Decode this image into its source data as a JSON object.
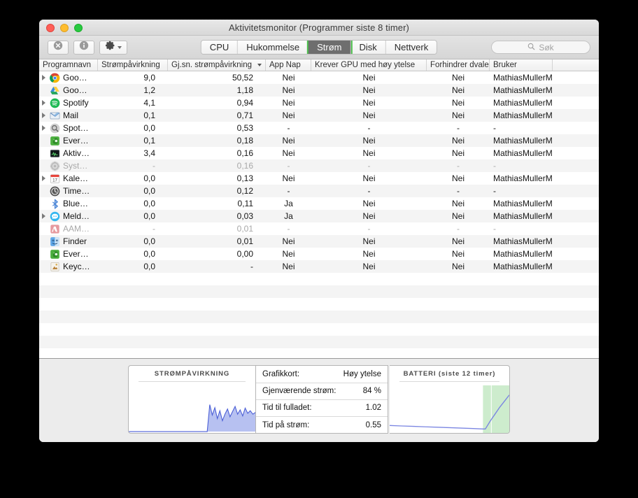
{
  "window": {
    "title": "Aktivitetsmonitor (Programmer siste 8 timer)",
    "traffic": {
      "close": "close-button",
      "minimize": "minimize-button",
      "maximize": "maximize-button"
    }
  },
  "toolbar": {
    "quit_process_icon": "stop-process-icon",
    "inspect_icon": "info-icon",
    "gear_icon": "gear-icon",
    "tabs": [
      {
        "label": "CPU",
        "selected": false
      },
      {
        "label": "Hukommelse",
        "selected": false
      },
      {
        "label": "Strøm",
        "selected": true
      },
      {
        "label": "Disk",
        "selected": false
      },
      {
        "label": "Nettverk",
        "selected": false
      }
    ],
    "search": {
      "placeholder": "Søk",
      "icon": "search-icon",
      "value": ""
    },
    "selected_tab_outline": "#4cc14c",
    "selected_tab_fill": "#6e6e6e"
  },
  "table": {
    "columns": [
      {
        "key": "name",
        "label": "Programnavn",
        "sorted": false
      },
      {
        "key": "imp",
        "label": "Strømpåvirkning",
        "sorted": false
      },
      {
        "key": "avg",
        "label": "Gj.sn. strømpåvirkning",
        "sorted": true
      },
      {
        "key": "nap",
        "label": "App Nap",
        "sorted": false
      },
      {
        "key": "gpu",
        "label": "Krever GPU med høy ytelse",
        "sorted": false
      },
      {
        "key": "sleep",
        "label": "Forhindrer dvale",
        "sorted": false
      },
      {
        "key": "user",
        "label": "Bruker",
        "sorted": false
      }
    ],
    "rows": [
      {
        "name": "Goo…",
        "icon": "chrome",
        "disclosure": true,
        "inactive": false,
        "imp": "9,0",
        "avg": "50,52",
        "nap": "Nei",
        "gpu": "Nei",
        "sleep": "Nei",
        "user": "MathiasMullerM"
      },
      {
        "name": "Goo…",
        "icon": "gdrive",
        "disclosure": false,
        "inactive": false,
        "imp": "1,2",
        "avg": "1,18",
        "nap": "Nei",
        "gpu": "Nei",
        "sleep": "Nei",
        "user": "MathiasMullerM"
      },
      {
        "name": "Spotify",
        "icon": "spotify",
        "disclosure": true,
        "inactive": false,
        "imp": "4,1",
        "avg": "0,94",
        "nap": "Nei",
        "gpu": "Nei",
        "sleep": "Nei",
        "user": "MathiasMullerM"
      },
      {
        "name": "Mail",
        "icon": "mail",
        "disclosure": true,
        "inactive": false,
        "imp": "0,1",
        "avg": "0,71",
        "nap": "Nei",
        "gpu": "Nei",
        "sleep": "Nei",
        "user": "MathiasMullerM"
      },
      {
        "name": "Spot…",
        "icon": "spotlight",
        "disclosure": true,
        "inactive": false,
        "imp": "0,0",
        "avg": "0,53",
        "nap": "-",
        "gpu": "-",
        "sleep": "-",
        "user": "-"
      },
      {
        "name": "Ever…",
        "icon": "evernote",
        "disclosure": false,
        "inactive": false,
        "imp": "0,1",
        "avg": "0,18",
        "nap": "Nei",
        "gpu": "Nei",
        "sleep": "Nei",
        "user": "MathiasMullerM"
      },
      {
        "name": "Aktiv…",
        "icon": "activity",
        "disclosure": false,
        "inactive": false,
        "imp": "3,4",
        "avg": "0,16",
        "nap": "Nei",
        "gpu": "Nei",
        "sleep": "Nei",
        "user": "MathiasMullerM"
      },
      {
        "name": "Syst…",
        "icon": "prefs",
        "disclosure": false,
        "inactive": true,
        "imp": "-",
        "avg": "0,16",
        "nap": "-",
        "gpu": "-",
        "sleep": "-",
        "user": "-"
      },
      {
        "name": "Kale…",
        "icon": "calendar",
        "disclosure": true,
        "inactive": false,
        "imp": "0,0",
        "avg": "0,13",
        "nap": "Nei",
        "gpu": "Nei",
        "sleep": "Nei",
        "user": "MathiasMullerM"
      },
      {
        "name": "Time…",
        "icon": "timemachine",
        "disclosure": false,
        "inactive": false,
        "imp": "0,0",
        "avg": "0,12",
        "nap": "-",
        "gpu": "-",
        "sleep": "-",
        "user": "-"
      },
      {
        "name": "Blue…",
        "icon": "bluetooth",
        "disclosure": false,
        "inactive": false,
        "imp": "0,0",
        "avg": "0,11",
        "nap": "Ja",
        "gpu": "Nei",
        "sleep": "Nei",
        "user": "MathiasMullerM"
      },
      {
        "name": "Meld…",
        "icon": "messages",
        "disclosure": true,
        "inactive": false,
        "imp": "0,0",
        "avg": "0,03",
        "nap": "Ja",
        "gpu": "Nei",
        "sleep": "Nei",
        "user": "MathiasMullerM"
      },
      {
        "name": "AAM…",
        "icon": "adobe",
        "disclosure": false,
        "inactive": true,
        "imp": "-",
        "avg": "0,01",
        "nap": "-",
        "gpu": "-",
        "sleep": "-",
        "user": "-"
      },
      {
        "name": "Finder",
        "icon": "finder",
        "disclosure": false,
        "inactive": false,
        "imp": "0,0",
        "avg": "0,01",
        "nap": "Nei",
        "gpu": "Nei",
        "sleep": "Nei",
        "user": "MathiasMullerM"
      },
      {
        "name": "Ever…",
        "icon": "evernote",
        "disclosure": false,
        "inactive": false,
        "imp": "0,0",
        "avg": "0,00",
        "nap": "Nei",
        "gpu": "Nei",
        "sleep": "Nei",
        "user": "MathiasMullerM"
      },
      {
        "name": "Keyc…",
        "icon": "keychain",
        "disclosure": false,
        "inactive": false,
        "imp": "0,0",
        "avg": "-",
        "nap": "Nei",
        "gpu": "Nei",
        "sleep": "Nei",
        "user": "MathiasMullerM"
      }
    ],
    "empty_rows": 7
  },
  "bottom": {
    "power_graph": {
      "title": "STRØMPÅVIRKNING",
      "line_color": "#5a6ee0",
      "fill_color": "#aab6ef"
    },
    "battery_graph": {
      "title": "BATTERI (siste 12 timer)",
      "line_color": "#7b86e2",
      "charging_band_color": "#cdeccd"
    },
    "stats": [
      {
        "label": "Grafikkort:",
        "value": "Høy ytelse"
      },
      {
        "label": "Gjenværende strøm:",
        "value": "84 %"
      },
      {
        "label": "Tid til fulladet:",
        "value": "1.02"
      },
      {
        "label": "Tid på strøm:",
        "value": "0.55"
      }
    ]
  },
  "chart_data": [
    {
      "type": "area",
      "title": "STRØMPÅVIRKNING",
      "xlabel": "",
      "ylabel": "",
      "x": [
        0,
        5,
        10,
        15,
        20,
        25,
        30,
        35,
        40,
        45,
        50,
        55,
        60,
        62,
        64,
        66,
        68,
        70,
        72,
        74,
        76,
        78,
        80,
        82,
        84,
        86,
        88,
        90,
        92,
        94,
        96,
        98,
        100
      ],
      "values": [
        0,
        0,
        0,
        0,
        0,
        0,
        0,
        0,
        0,
        0,
        0,
        0,
        0,
        0,
        62,
        38,
        55,
        30,
        48,
        25,
        40,
        52,
        34,
        46,
        58,
        40,
        50,
        36,
        54,
        42,
        48,
        40,
        44
      ],
      "ylim": [
        0,
        100
      ],
      "grid": false,
      "legend": "none"
    },
    {
      "type": "line",
      "title": "BATTERI (siste 12 timer)",
      "xlabel": "",
      "ylabel": "",
      "x": [
        0,
        10,
        20,
        30,
        40,
        50,
        60,
        70,
        78,
        80,
        84,
        88,
        92,
        96,
        100
      ],
      "values": [
        14,
        13,
        12,
        11,
        10,
        9,
        8,
        7,
        6,
        6,
        24,
        40,
        56,
        70,
        84
      ],
      "ylim": [
        0,
        100
      ],
      "annotations": [
        {
          "type": "band",
          "label": "charging",
          "x_start": 78,
          "x_end": 100,
          "color": "#cdeccd"
        }
      ],
      "grid": false,
      "legend": "none"
    }
  ]
}
